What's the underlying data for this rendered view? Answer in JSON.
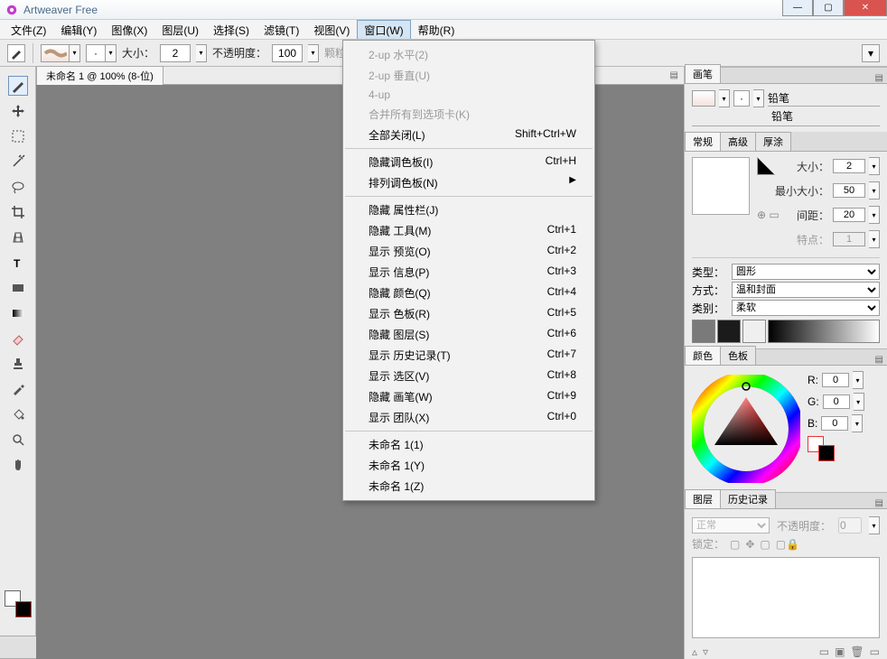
{
  "window": {
    "title": "Artweaver Free"
  },
  "menubar": {
    "items": [
      "文件(Z)",
      "编辑(Y)",
      "图像(X)",
      "图层(U)",
      "选择(S)",
      "滤镜(T)",
      "视图(V)",
      "窗口(W)",
      "帮助(R)"
    ],
    "activeIndex": 7
  },
  "optionsbar": {
    "size_label": "大小：",
    "size_value": "2",
    "opacity_label": "不透明度：",
    "opacity_value": "100",
    "grain_label": "颗粒"
  },
  "dropdown": {
    "groups": [
      {
        "items": [
          {
            "label": "2-up 水平(2)",
            "shortcut": "",
            "disabled": true
          },
          {
            "label": "2-up 垂直(U)",
            "shortcut": "",
            "disabled": true
          },
          {
            "label": "4-up",
            "shortcut": "",
            "disabled": true
          },
          {
            "label": "合并所有到选项卡(K)",
            "shortcut": "",
            "disabled": true
          },
          {
            "label": "全部关闭(L)",
            "shortcut": "Shift+Ctrl+W",
            "disabled": false
          }
        ]
      },
      {
        "items": [
          {
            "label": "隐藏调色板(I)",
            "shortcut": "Ctrl+H",
            "disabled": false
          },
          {
            "label": "排列调色板(N)",
            "shortcut": "",
            "disabled": false,
            "submenu": true
          }
        ]
      },
      {
        "items": [
          {
            "label": "隐藏 属性栏(J)",
            "shortcut": "",
            "disabled": false
          },
          {
            "label": "隐藏 工具(M)",
            "shortcut": "Ctrl+1",
            "disabled": false
          },
          {
            "label": "显示 预览(O)",
            "shortcut": "Ctrl+2",
            "disabled": false
          },
          {
            "label": "显示 信息(P)",
            "shortcut": "Ctrl+3",
            "disabled": false
          },
          {
            "label": "隐藏 颜色(Q)",
            "shortcut": "Ctrl+4",
            "disabled": false
          },
          {
            "label": "显示 色板(R)",
            "shortcut": "Ctrl+5",
            "disabled": false
          },
          {
            "label": "隐藏 图层(S)",
            "shortcut": "Ctrl+6",
            "disabled": false
          },
          {
            "label": "显示 历史记录(T)",
            "shortcut": "Ctrl+7",
            "disabled": false
          },
          {
            "label": "显示 选区(V)",
            "shortcut": "Ctrl+8",
            "disabled": false
          },
          {
            "label": "隐藏 画笔(W)",
            "shortcut": "Ctrl+9",
            "disabled": false
          },
          {
            "label": "显示 团队(X)",
            "shortcut": "Ctrl+0",
            "disabled": false
          }
        ]
      },
      {
        "items": [
          {
            "label": "未命名 1(1)",
            "shortcut": "",
            "disabled": false
          },
          {
            "label": "未命名 1(Y)",
            "shortcut": "",
            "disabled": false
          },
          {
            "label": "未命名 1(Z)",
            "shortcut": "",
            "disabled": false
          }
        ]
      }
    ]
  },
  "document": {
    "tab_label": "未命名 1 @ 100% (8-位)"
  },
  "brush_panel": {
    "tab": "画笔",
    "type_label": "铅笔",
    "variant_label": "铅笔",
    "subtabs": [
      "常规",
      "高级",
      "厚涂"
    ],
    "size_label": "大小：",
    "size_value": "2",
    "minsize_label": "最小大小：",
    "minsize_value": "50",
    "spacing_label": "间距：",
    "spacing_value": "20",
    "feature_label": "特点：",
    "feature_value": "1",
    "shape_label": "类型：",
    "shape_value": "圆形",
    "method_label": "方式：",
    "method_value": "温和封面",
    "category_label": "类别：",
    "category_value": "柔软"
  },
  "color_panel": {
    "tabs": [
      "颜色",
      "色板"
    ],
    "r_label": "R:",
    "r_value": "0",
    "g_label": "G:",
    "g_value": "0",
    "b_label": "B:",
    "b_value": "0"
  },
  "layers_panel": {
    "tabs": [
      "图层",
      "历史记录"
    ],
    "blend_label": "正常",
    "opacity_label": "不透明度：",
    "opacity_value": "0",
    "lock_label": "锁定："
  }
}
